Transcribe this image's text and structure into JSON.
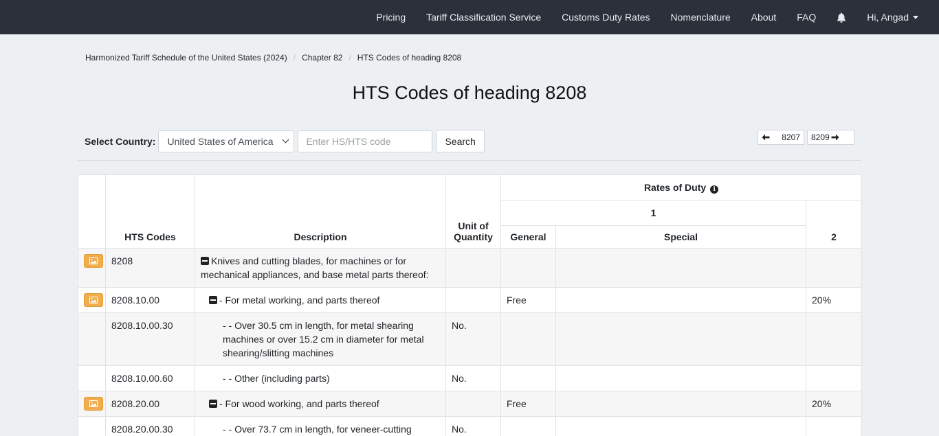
{
  "nav": {
    "items": [
      "Pricing",
      "Tariff Classification Service",
      "Customs Duty Rates",
      "Nomenclature",
      "About",
      "FAQ"
    ],
    "user_label": "Hi, Angad"
  },
  "breadcrumb": [
    "Harmonized Tariff Schedule of the United States (2024)",
    "Chapter 82",
    "HTS Codes of heading 8208"
  ],
  "page": {
    "title": "HTS Codes of heading 8208"
  },
  "search": {
    "country_label": "Select Country:",
    "country_value": "United States of America",
    "code_placeholder": "Enter HS/HTS code",
    "button_label": "Search"
  },
  "pager": {
    "prev": "8207",
    "next": "8209"
  },
  "table": {
    "headers": {
      "hts_codes": "HTS Codes",
      "description": "Description",
      "unit": "Unit of Quantity",
      "rates": "Rates of Duty",
      "col1": "1",
      "general": "General",
      "special": "Special",
      "col2": "2"
    },
    "rows": [
      {
        "has_image": true,
        "code": "8208",
        "collapsible": true,
        "indent": 0,
        "description": "Knives and cutting blades, for machines or for mechanical appliances, and base metal parts thereof:",
        "unit": "",
        "general": "",
        "special": "",
        "col2": ""
      },
      {
        "has_image": true,
        "code": "8208.10.00",
        "collapsible": true,
        "indent": 1,
        "description": "- For metal working, and parts thereof",
        "unit": "",
        "general": "Free",
        "special": "",
        "col2": "20%"
      },
      {
        "has_image": false,
        "code": "8208.10.00.30",
        "collapsible": false,
        "indent": 2,
        "description": "- - Over 30.5 cm in length, for metal shearing machines or over 15.2 cm in diameter for metal shearing/slitting machines",
        "unit": "No.",
        "general": "",
        "special": "",
        "col2": ""
      },
      {
        "has_image": false,
        "code": "8208.10.00.60",
        "collapsible": false,
        "indent": 2,
        "description": "- - Other (including parts)",
        "unit": "No.",
        "general": "",
        "special": "",
        "col2": ""
      },
      {
        "has_image": true,
        "code": "8208.20.00",
        "collapsible": true,
        "indent": 1,
        "description": "- For wood working, and parts thereof",
        "unit": "",
        "general": "Free",
        "special": "",
        "col2": "20%"
      },
      {
        "has_image": false,
        "code": "8208.20.00.30",
        "collapsible": false,
        "indent": 2,
        "description": "- - Over 73.7 cm in length, for veneer-cutting",
        "unit": "No.",
        "general": "",
        "special": "",
        "col2": ""
      }
    ]
  },
  "colors": {
    "navbar_bg": "#2b303a",
    "page_bg": "#ecf0f3",
    "image_button": "#f0ad4e"
  },
  "icons": [
    "bell-icon",
    "caret-down-icon",
    "arrow-left-icon",
    "arrow-right-icon",
    "image-icon",
    "collapse-minus-icon",
    "info-circle-icon"
  ]
}
